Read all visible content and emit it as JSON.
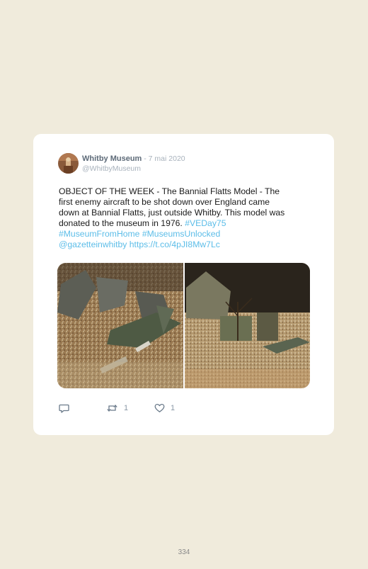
{
  "tweet": {
    "author_name": "Whitby Museum",
    "date": " - 7 mai 2020",
    "handle": "@WhitbyMuseum",
    "text_lines": [
      "OBJECT OF THE WEEK - The Bannial Flatts Model - The",
      "first enemy aircraft to be shot down over England came",
      "down at Bannial Flatts, just outside Whitby. This model was",
      "donated to the museum in 1976. "
    ],
    "hashtag_1": "#VEDay75",
    "hashtag_2": "#MuseumFromHome",
    "hashtag_3": "#MuseumsUnlocked",
    "mention": "@gazetteinwhitby",
    "url": "https://t.co/4pJI8Mw7Lc",
    "retweet_count": "1",
    "like_count": "1",
    "link_color": "#5cbde8"
  },
  "icons": {
    "reply": "reply-icon",
    "retweet": "retweet-icon",
    "like": "heart-icon"
  },
  "page": {
    "number": "334"
  }
}
